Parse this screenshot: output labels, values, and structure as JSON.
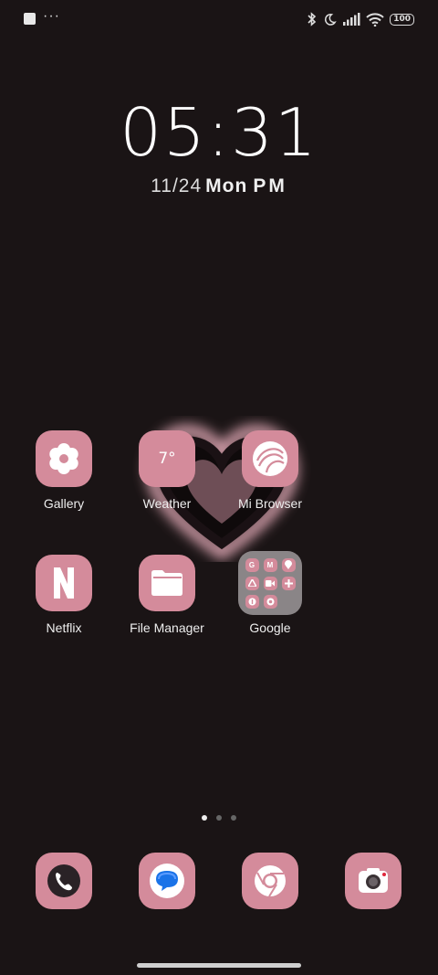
{
  "status_bar": {
    "left_icons": [
      "notification-square-icon",
      "more-dots-icon"
    ],
    "right_icons": [
      "bluetooth-icon",
      "moon-icon",
      "signal-icon",
      "wifi-icon",
      "battery-icon"
    ],
    "battery": "100"
  },
  "clock": {
    "time": "05:31",
    "date": "11/24",
    "weekday": "Mon",
    "ampm": "PM"
  },
  "apps": [
    {
      "label": "Gallery",
      "icon": "flower-icon"
    },
    {
      "label": "Weather",
      "icon": "weather-icon",
      "temp": "7°"
    },
    {
      "label": "Mi Browser",
      "icon": "browser-swirl-icon"
    },
    {
      "label": "Netflix",
      "icon": "netflix-n-icon"
    },
    {
      "label": "File Manager",
      "icon": "folder-icon"
    },
    {
      "label": "Google",
      "icon": "google-folder-icon"
    }
  ],
  "google_folder_mini": [
    "G",
    "M",
    "",
    "",
    "",
    "",
    "",
    "",
    ""
  ],
  "pager": {
    "pages": 3,
    "current": 1
  },
  "dock": [
    {
      "icon": "phone-icon"
    },
    {
      "icon": "messages-icon"
    },
    {
      "icon": "chrome-icon"
    },
    {
      "icon": "camera-icon"
    }
  ],
  "colors": {
    "background": "#1a1415",
    "icon_pink": "#d48b9b",
    "folder_gray": "#8a8587"
  }
}
